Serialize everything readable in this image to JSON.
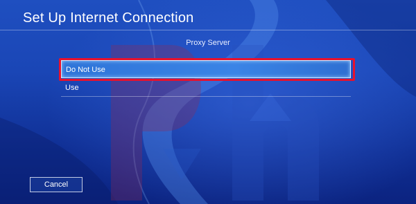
{
  "header": {
    "title": "Set Up Internet Connection"
  },
  "section": {
    "label": "Proxy Server"
  },
  "options": [
    {
      "label": "Do Not Use",
      "selected": true
    },
    {
      "label": "Use",
      "selected": false
    }
  ],
  "footer": {
    "cancel_label": "Cancel"
  },
  "colors": {
    "background": "#1a46b6",
    "selection": "#3a84e6",
    "annotation_box": "#e8112d",
    "text": "#ffffff"
  }
}
